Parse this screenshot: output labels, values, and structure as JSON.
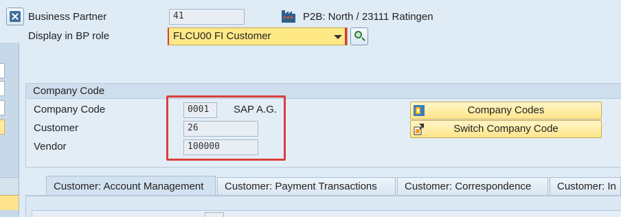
{
  "header": {
    "business_partner_label": "Business Partner",
    "business_partner_value": "41",
    "org_text": "P2B: North / 23111 Ratingen",
    "bp_role_label": "Display in BP role",
    "bp_role_value": "FLCU00 FI Customer"
  },
  "company_code_group": {
    "title": "Company Code",
    "fields": [
      {
        "label": "Company Code",
        "value": "0001",
        "description": "SAP A.G."
      },
      {
        "label": "Customer",
        "value": "26"
      },
      {
        "label": "Vendor",
        "value": "100000"
      }
    ],
    "buttons": {
      "company_codes": "Company Codes",
      "switch_company_code": "Switch Company Code"
    }
  },
  "tabs": [
    {
      "label": "Customer: Account Management",
      "active": true
    },
    {
      "label": "Customer: Payment Transactions",
      "active": false
    },
    {
      "label": "Customer: Correspondence",
      "active": false
    },
    {
      "label": "Customer: In",
      "active": false
    }
  ],
  "colors": {
    "highlight_border": "#d9403a",
    "required_marker": "#d63a3a",
    "button_yellow": "#ffe58a",
    "background": "#dfebf5"
  },
  "icons": {
    "header_icon": "exit-icon",
    "org_icon": "building-icon",
    "search_icon": "search-icon",
    "company_codes_icon": "list-icon",
    "switch_icon": "switch-icon"
  }
}
